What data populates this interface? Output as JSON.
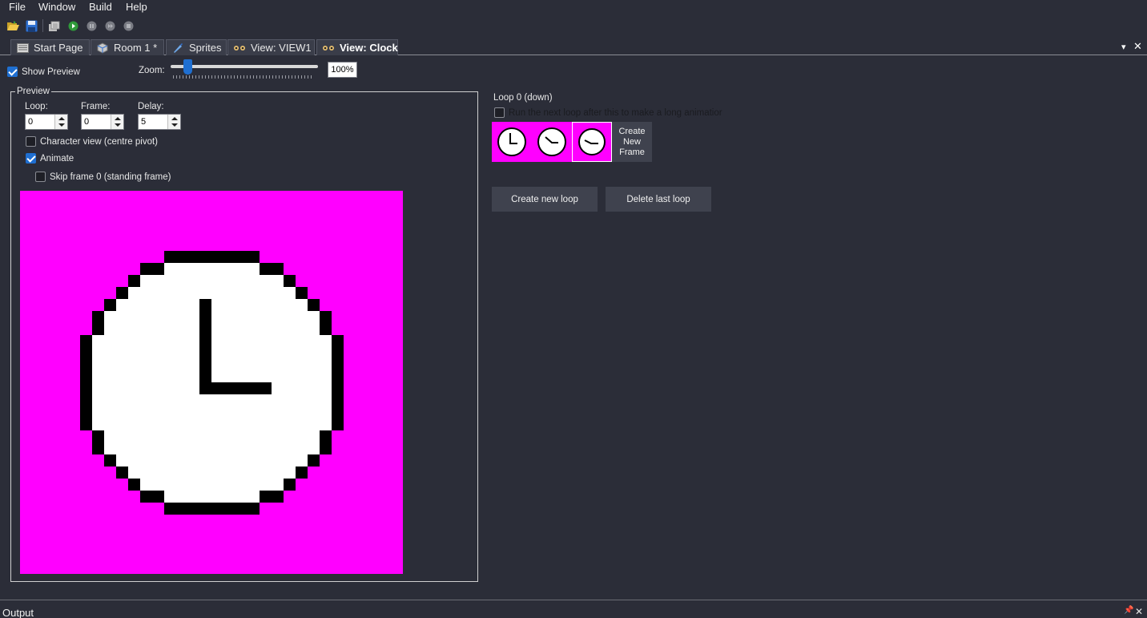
{
  "menu": {
    "items": [
      "File",
      "Window",
      "Build",
      "Help"
    ]
  },
  "toolbar": {
    "icons": [
      "open-folder-icon",
      "save-icon",
      "build-icon",
      "run-icon",
      "pause-icon",
      "step-icon",
      "stop-icon"
    ]
  },
  "tabs": [
    {
      "label": "Start Page",
      "icon": "start-page-icon"
    },
    {
      "label": "Room 1 *",
      "icon": "room-icon"
    },
    {
      "label": "Sprites",
      "icon": "sprites-icon"
    },
    {
      "label": "View: VIEW1",
      "icon": "view-icon"
    },
    {
      "label": "View: Clock",
      "icon": "view-icon",
      "active": true
    }
  ],
  "tab_controls": {
    "dropdown": "▾",
    "close": "✕"
  },
  "show_preview": {
    "label": "Show Preview",
    "checked": true
  },
  "zoom": {
    "label": "Zoom:",
    "value": "100%",
    "slider_level_percent": 10
  },
  "preview": {
    "title": "Preview",
    "loop": {
      "label": "Loop:",
      "value": "0"
    },
    "frame": {
      "label": "Frame:",
      "value": "0"
    },
    "delay": {
      "label": "Delay:",
      "value": "5"
    },
    "character_view": {
      "label": "Character view (centre pivot)",
      "checked": false
    },
    "animate": {
      "label": "Animate",
      "checked": true
    },
    "skip_frame": {
      "label": "Skip frame 0 (standing frame)",
      "checked": false
    },
    "background_color": "#ff00ff"
  },
  "loop_panel": {
    "title": "Loop 0 (down)",
    "run_next": {
      "label": "Run the next loop after this to make a long animatior",
      "checked": false
    },
    "frames": [
      {
        "hand": "hour-minute"
      },
      {
        "hand": "tilted"
      },
      {
        "hand": "tilted-selected"
      }
    ],
    "create_frame": "Create New Frame",
    "create_loop": "Create new loop",
    "delete_loop": "Delete last loop"
  },
  "status": {
    "title": "Output",
    "pin": "📌",
    "close": "✕"
  },
  "colors": {
    "background": "#2b2d38",
    "accent": "#1f6fd1",
    "magenta": "#ff00ff"
  }
}
